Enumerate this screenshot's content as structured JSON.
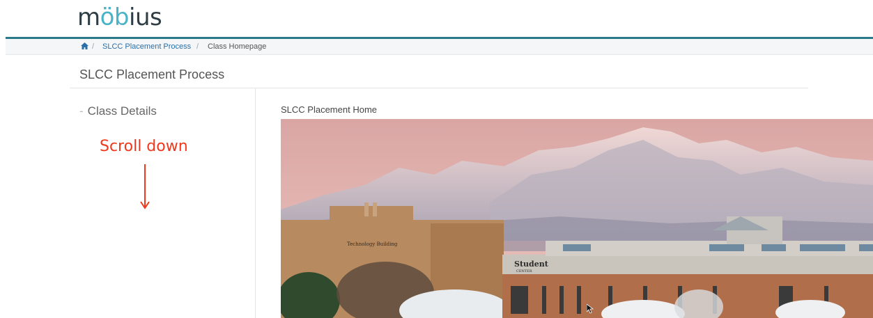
{
  "header": {
    "logo_text": "möbius"
  },
  "breadcrumb": {
    "home_icon": "home-icon",
    "items": [
      "SLCC Placement Process",
      "Class Homepage"
    ]
  },
  "course": {
    "title": "SLCC Placement Process"
  },
  "sidebar": {
    "item_label": "Class Details"
  },
  "annotation": {
    "text": "Scroll down"
  },
  "content": {
    "heading": "SLCC Placement Home",
    "image": {
      "building_left_sign": "Technology Building",
      "building_right_sign": "Student CENTER"
    }
  },
  "colors": {
    "accent": "#2a7a8a",
    "link": "#2a6fa8",
    "annotation": "#f0391c"
  }
}
